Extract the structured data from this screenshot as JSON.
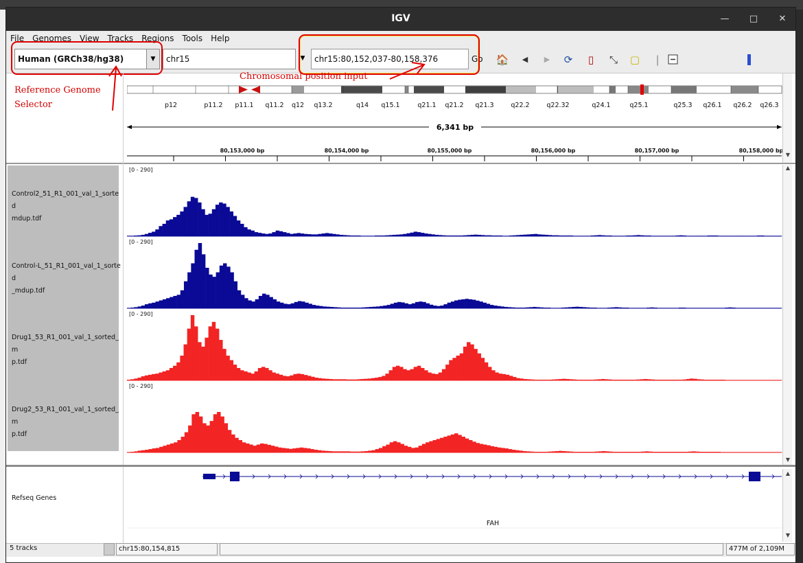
{
  "window": {
    "title": "IGV"
  },
  "menu": [
    "File",
    "Genomes",
    "View",
    "Tracks",
    "Regions",
    "Tools",
    "Help"
  ],
  "toolbar": {
    "genome": "Human (GRCh38/hg38)",
    "chromosome": "chr15",
    "locus": "chr15:80,152,037-80,158,376",
    "go_label": "Go"
  },
  "annotations": {
    "genome_selector": "Reference Genome Selector",
    "genome_selector_l1": "Reference  Genome",
    "genome_selector_l2": "Selector",
    "position_input": "Chromosomal  position  input"
  },
  "ideogram": {
    "bands": [
      "p12",
      "p11.2",
      "p11.1",
      "q11.2",
      "q12",
      "q13.2",
      "q14",
      "q15.1",
      "q21.1",
      "q21.2",
      "q21.3",
      "q22.2",
      "q22.32",
      "q24.1",
      "q25.1",
      "q25.3",
      "q26.1",
      "q26.2",
      "q26.3"
    ]
  },
  "ruler": {
    "span": "6,341 bp",
    "ticks": [
      "80,153,000 bp",
      "80,154,000 bp",
      "80,155,000 bp",
      "80,156,000 bp",
      "80,157,000 bp",
      "80,158,000 bp"
    ]
  },
  "tracks": [
    {
      "name_l1": "Control2_51_R1_001_val_1_sorted",
      "name_l2": "mdup.tdf",
      "range": "[0 - 290]",
      "color": "#0a0a96",
      "values": [
        2,
        2,
        3,
        4,
        6,
        10,
        15,
        20,
        30,
        45,
        55,
        70,
        75,
        85,
        95,
        110,
        130,
        155,
        175,
        170,
        150,
        120,
        95,
        100,
        120,
        140,
        150,
        145,
        130,
        110,
        90,
        70,
        55,
        40,
        30,
        25,
        18,
        15,
        12,
        10,
        12,
        18,
        25,
        22,
        18,
        14,
        10,
        12,
        14,
        12,
        10,
        9,
        8,
        8,
        10,
        12,
        14,
        12,
        10,
        8,
        6,
        5,
        4,
        3,
        3,
        3,
        2,
        2,
        2,
        2,
        3,
        3,
        3,
        4,
        5,
        6,
        7,
        8,
        10,
        13,
        16,
        20,
        18,
        15,
        12,
        10,
        8,
        6,
        5,
        4,
        3,
        3,
        3,
        3,
        3,
        4,
        5,
        6,
        7,
        6,
        5,
        4,
        4,
        3,
        3,
        3,
        2,
        2,
        3,
        4,
        5,
        6,
        7,
        8,
        9,
        10,
        8,
        7,
        6,
        5,
        4,
        4,
        3,
        3,
        3,
        3,
        2,
        2,
        2,
        2,
        2,
        3,
        4,
        5,
        4,
        3,
        3,
        2,
        2,
        2,
        2,
        3,
        3,
        4,
        5,
        4,
        3,
        3,
        2,
        2,
        2,
        2,
        2,
        2,
        2,
        3,
        4,
        3,
        2,
        2,
        2,
        2,
        2,
        2,
        3,
        3,
        3,
        2,
        2,
        2,
        2,
        2,
        2,
        2,
        2,
        2,
        2,
        2,
        3,
        3,
        2,
        2,
        2,
        2,
        2
      ]
    },
    {
      "name_l1": "Control-L_51_R1_001_val_1_sorted",
      "name_l2": "_mdup.tdf",
      "range": "[0 - 290]",
      "color": "#0a0a96",
      "values": [
        2,
        3,
        5,
        8,
        12,
        18,
        22,
        25,
        30,
        35,
        40,
        45,
        50,
        55,
        60,
        80,
        120,
        160,
        200,
        260,
        290,
        240,
        180,
        150,
        140,
        160,
        190,
        200,
        185,
        160,
        120,
        80,
        60,
        45,
        35,
        30,
        40,
        55,
        65,
        60,
        50,
        40,
        30,
        25,
        20,
        18,
        22,
        28,
        32,
        30,
        25,
        20,
        15,
        12,
        10,
        8,
        7,
        6,
        5,
        4,
        3,
        3,
        3,
        3,
        3,
        3,
        4,
        5,
        6,
        7,
        8,
        10,
        12,
        15,
        20,
        25,
        28,
        26,
        22,
        18,
        22,
        28,
        30,
        28,
        22,
        16,
        12,
        10,
        12,
        18,
        25,
        30,
        35,
        38,
        40,
        42,
        40,
        38,
        34,
        30,
        25,
        20,
        15,
        12,
        10,
        8,
        6,
        5,
        4,
        3,
        3,
        3,
        4,
        5,
        6,
        5,
        4,
        3,
        3,
        2,
        2,
        2,
        3,
        4,
        5,
        6,
        7,
        6,
        5,
        4,
        3,
        3,
        2,
        2,
        2,
        3,
        4,
        5,
        4,
        3,
        3,
        2,
        2,
        2,
        2,
        2,
        3,
        4,
        3,
        2,
        2,
        2,
        2,
        2,
        2,
        3,
        3,
        2,
        2,
        2,
        2,
        2,
        2,
        2,
        2,
        2,
        2,
        2,
        3,
        4,
        3,
        2,
        2,
        2,
        2,
        2,
        2,
        2,
        2,
        2,
        2,
        2,
        2,
        2
      ]
    },
    {
      "name_l1": "Drug1_53_R1_001_val_1_sorted_m",
      "name_l2": "p.tdf",
      "range": "[0 - 290]",
      "color": "#f22424",
      "values": [
        3,
        5,
        8,
        12,
        18,
        22,
        25,
        28,
        30,
        35,
        40,
        45,
        55,
        65,
        80,
        110,
        160,
        230,
        290,
        240,
        170,
        150,
        190,
        240,
        260,
        230,
        180,
        140,
        110,
        90,
        70,
        55,
        45,
        40,
        35,
        30,
        40,
        55,
        60,
        55,
        45,
        35,
        30,
        25,
        20,
        18,
        22,
        28,
        30,
        28,
        24,
        20,
        16,
        12,
        10,
        8,
        7,
        6,
        5,
        5,
        5,
        5,
        4,
        4,
        4,
        5,
        6,
        7,
        8,
        10,
        12,
        15,
        20,
        30,
        45,
        60,
        65,
        60,
        50,
        45,
        50,
        60,
        65,
        55,
        45,
        35,
        30,
        28,
        35,
        50,
        70,
        90,
        100,
        110,
        120,
        150,
        170,
        160,
        140,
        120,
        100,
        80,
        60,
        45,
        35,
        30,
        28,
        25,
        20,
        15,
        10,
        8,
        6,
        5,
        4,
        3,
        3,
        3,
        3,
        3,
        4,
        5,
        6,
        7,
        6,
        5,
        4,
        3,
        3,
        3,
        3,
        3,
        4,
        5,
        6,
        5,
        4,
        3,
        3,
        3,
        3,
        3,
        3,
        3,
        4,
        5,
        6,
        5,
        4,
        3,
        3,
        3,
        3,
        3,
        3,
        3,
        3,
        4,
        6,
        8,
        7,
        5,
        4,
        3,
        3,
        3,
        3,
        3,
        3,
        2,
        2,
        2,
        2,
        2,
        2,
        2,
        2,
        2,
        2,
        2,
        2,
        2,
        2,
        2,
        2
      ]
    },
    {
      "name_l1": "Drug2_53_R1_001_val_1_sorted_m",
      "name_l2": "p.tdf",
      "range": "[0 - 290]",
      "color": "#f22424",
      "values": [
        2,
        3,
        5,
        8,
        10,
        12,
        15,
        18,
        20,
        25,
        30,
        35,
        40,
        45,
        55,
        70,
        90,
        120,
        170,
        180,
        160,
        130,
        120,
        140,
        170,
        180,
        160,
        130,
        100,
        80,
        65,
        55,
        45,
        40,
        35,
        30,
        35,
        40,
        38,
        34,
        30,
        26,
        22,
        20,
        18,
        16,
        18,
        20,
        22,
        20,
        18,
        15,
        12,
        10,
        8,
        7,
        6,
        5,
        5,
        5,
        5,
        5,
        4,
        4,
        4,
        5,
        6,
        8,
        10,
        15,
        20,
        28,
        35,
        45,
        50,
        45,
        38,
        30,
        25,
        20,
        22,
        30,
        38,
        45,
        50,
        55,
        60,
        65,
        70,
        75,
        80,
        85,
        78,
        70,
        62,
        55,
        48,
        42,
        38,
        35,
        32,
        28,
        25,
        22,
        20,
        18,
        15,
        12,
        10,
        8,
        6,
        5,
        4,
        3,
        3,
        3,
        3,
        4,
        5,
        6,
        7,
        6,
        5,
        4,
        3,
        3,
        3,
        3,
        3,
        3,
        4,
        5,
        6,
        5,
        4,
        3,
        3,
        3,
        3,
        3,
        3,
        3,
        3,
        4,
        5,
        4,
        3,
        3,
        3,
        3,
        3,
        3,
        3,
        3,
        3,
        3,
        4,
        5,
        4,
        3,
        3,
        3,
        3,
        3,
        3,
        2,
        2,
        2,
        2,
        2,
        2,
        2,
        2,
        2,
        2,
        2,
        2,
        2,
        2,
        2,
        2,
        2
      ]
    }
  ],
  "genes_track": {
    "name": "Refseq Genes",
    "gene": "FAH"
  },
  "status": {
    "tracks": "5 tracks",
    "position": "chr15:80,154,815",
    "memory": "477M of 2,109M"
  },
  "colors": {
    "control": "#0a0a96",
    "drug": "#f22424",
    "annotation": "#e00000"
  }
}
